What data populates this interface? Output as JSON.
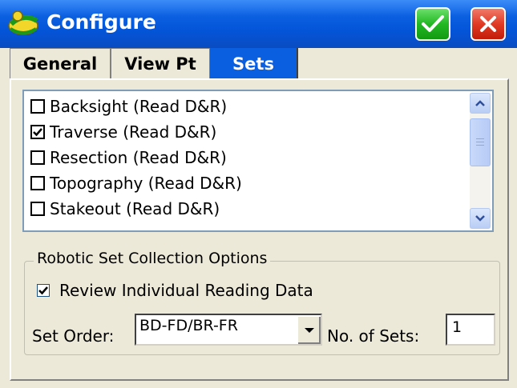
{
  "window": {
    "title": "Configure",
    "ok_icon": "check-icon",
    "close_icon": "close-icon"
  },
  "tabs": [
    {
      "label": "General",
      "active": false
    },
    {
      "label": "View Pt",
      "active": false
    },
    {
      "label": "Sets",
      "active": true
    }
  ],
  "sets_list": {
    "items": [
      {
        "label": "Backsight (Read D&R)",
        "checked": false
      },
      {
        "label": "Traverse (Read D&R)",
        "checked": true
      },
      {
        "label": "Resection (Read D&R)",
        "checked": false
      },
      {
        "label": "Topography (Read D&R)",
        "checked": false
      },
      {
        "label": "Stakeout (Read D&R)",
        "checked": false
      }
    ]
  },
  "robotic_options": {
    "group_title": "Robotic Set Collection Options",
    "review_label": "Review Individual Reading Data",
    "review_checked": true,
    "set_order_label": "Set Order:",
    "set_order_value": "BD-FD/BR-FR",
    "num_sets_label": "No. of Sets:",
    "num_sets_value": "1"
  },
  "colors": {
    "titlebar": "#0454d8",
    "active_tab": "#0a5ee0",
    "ok_button": "#23b823",
    "close_button": "#e03a24"
  }
}
